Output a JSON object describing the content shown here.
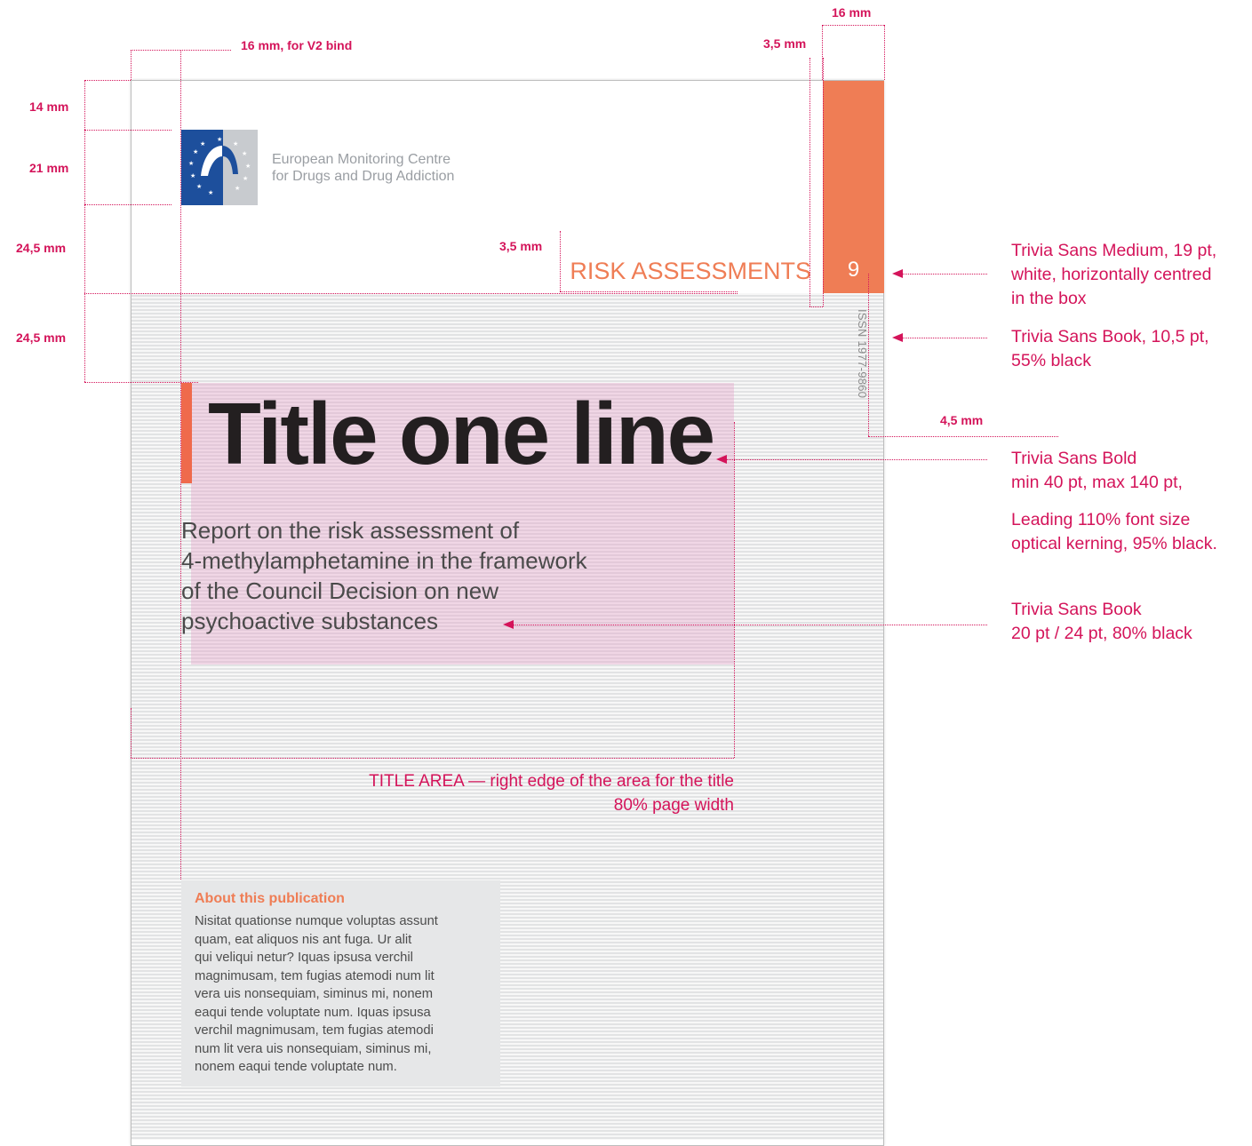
{
  "measurements": {
    "top_right_width": "16 mm",
    "bind": "16 mm, for V2 bind",
    "gap_top": "3,5 mm",
    "gap_series": "3,5 mm",
    "issn_offset": "4,5 mm",
    "left": [
      "14 mm",
      "21 mm",
      "24,5 mm",
      "24,5 mm"
    ]
  },
  "header": {
    "org_name_line1": "European Monitoring Centre",
    "org_name_line2": "for Drugs and Drug Addiction",
    "series_title": "RISK ASSESSMENTS",
    "series_number": "9",
    "issn": "ISSN 1977-9860"
  },
  "cover": {
    "title": "Title one line",
    "subtitle_lines": [
      "Report on the risk assessment of",
      "4-methylamphetamine in the framework",
      "of the Council Decision on new",
      "psychoactive substances"
    ],
    "title_area_note_line1": "TITLE AREA — right edge of the area for the title",
    "title_area_note_line2": "80% page width"
  },
  "about": {
    "title": "About this publication",
    "lines": [
      "Nisitat quationse numque voluptas assunt",
      "quam, eat aliquos nis ant fuga. Ur alit",
      "qui veliqui netur? Iquas ipsusa verchil",
      "magnimusam, tem fugias atemodi num lit",
      "vera uis nonsequiam, siminus mi, nonem",
      "eaqui tende voluptate num. Iquas ipsusa",
      "verchil magnimusam, tem fugias atemodi",
      "num lit vera uis nonsequiam, siminus mi,",
      "nonem eaqui tende voluptate num."
    ]
  },
  "annotations": {
    "series_number_spec": [
      "Trivia Sans Medium, 19 pt,",
      "white, horizontally centred",
      "in the box"
    ],
    "issn_spec": [
      "Trivia Sans Book, 10,5 pt,",
      "55% black"
    ],
    "title_spec": [
      "Trivia Sans Bold",
      "min 40 pt, max 140 pt,"
    ],
    "title_spec_2": [
      "Leading 110% font size",
      "optical kerning, 95% black."
    ],
    "subtitle_spec": [
      "Trivia Sans Book",
      "20 pt / 24 pt, 80% black"
    ]
  },
  "colors": {
    "accent_orange": "#ef7d55",
    "annotation_pink": "#d4145a",
    "eu_blue": "#1d4f9c"
  }
}
